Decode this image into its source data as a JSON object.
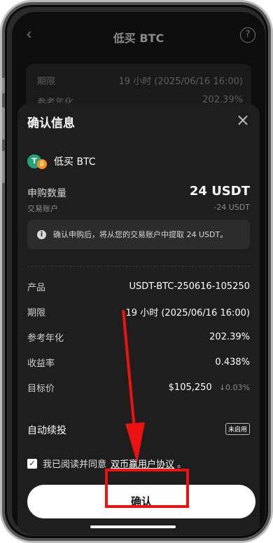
{
  "header": {
    "title": "低买 BTC"
  },
  "background": {
    "row1_label": "期限",
    "row1_value": "19 小时 (2025/06/16 16:00)",
    "row2_label": "参考年化",
    "row2_value": "202.39%"
  },
  "sheet": {
    "title": "确认信息",
    "product": {
      "name": "低买 BTC",
      "coin_primary": "T",
      "coin_secondary": "₿"
    },
    "amount": {
      "label": "申购数量",
      "value": "24 USDT",
      "account_label": "交易账户",
      "account_value": "-24 USDT"
    },
    "notice": "确认申购后，将从您的交易账户中提取 24 USDT。",
    "details": [
      {
        "label": "产品",
        "value": "USDT-BTC-250616-105250"
      },
      {
        "label": "期限",
        "value": "19 小时 (2025/06/16 16:00)"
      },
      {
        "label": "参考年化",
        "value": "202.39%"
      },
      {
        "label": "收益率",
        "value": "0.438%"
      },
      {
        "label": "目标价",
        "value": "$105,250",
        "change": "↓0.03%"
      }
    ],
    "auto_renew": {
      "label": "自动续投",
      "status": "未启用"
    },
    "agreement": {
      "prefix": "我已阅读并同意",
      "link": "双币赢用户协议",
      "suffix": "。"
    },
    "confirm_label": "确认"
  },
  "colors": {
    "annotation": "#ee1111",
    "tether": "#26a17b",
    "btc": "#f7931a"
  }
}
